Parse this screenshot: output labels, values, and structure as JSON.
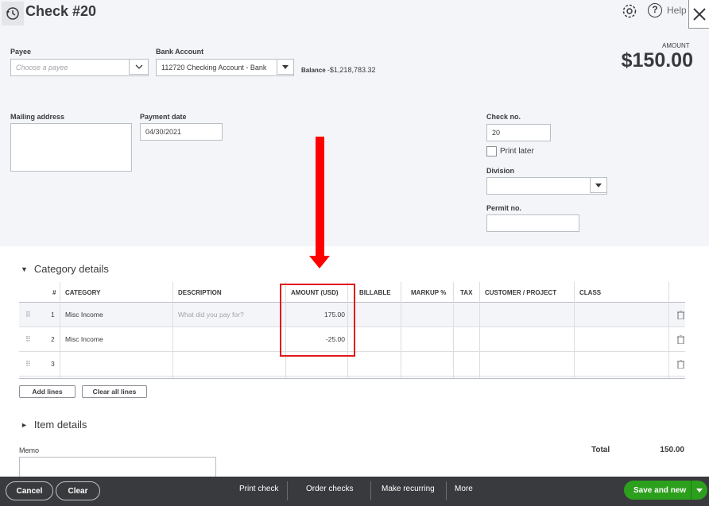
{
  "header": {
    "title": "Check #20",
    "help_label": "Help"
  },
  "form": {
    "payee_label": "Payee",
    "payee_placeholder": "Choose a payee",
    "bank_account_label": "Bank Account",
    "bank_account_value": "112720 Checking Account - Bank",
    "balance_label": "Balance",
    "balance_value": "-$1,218,783.32",
    "amount_label": "AMOUNT",
    "amount_value": "$150.00",
    "mailing_address_label": "Mailing address",
    "payment_date_label": "Payment date",
    "payment_date_value": "04/30/2021",
    "check_no_label": "Check no.",
    "check_no_value": "20",
    "print_later_label": "Print later",
    "division_label": "Division",
    "permit_no_label": "Permit no."
  },
  "category_details": {
    "title": "Category details",
    "columns": {
      "num": "#",
      "category": "CATEGORY",
      "description": "DESCRIPTION",
      "amount": "AMOUNT (USD)",
      "billable": "BILLABLE",
      "markup": "MARKUP %",
      "tax": "TAX",
      "customer": "CUSTOMER / PROJECT",
      "class": "CLASS"
    },
    "rows": [
      {
        "num": "1",
        "category": "Misc Income",
        "description_placeholder": "What did you pay for?",
        "amount": "175.00"
      },
      {
        "num": "2",
        "category": "Misc Income",
        "amount": "-25.00"
      },
      {
        "num": "3",
        "category": "",
        "amount": ""
      }
    ],
    "add_lines_label": "Add lines",
    "clear_lines_label": "Clear all lines"
  },
  "item_details": {
    "title": "Item details"
  },
  "memo_label": "Memo",
  "total_label": "Total",
  "total_value": "150.00",
  "footer": {
    "cancel": "Cancel",
    "clear": "Clear",
    "print_check": "Print check",
    "order_checks": "Order checks",
    "make_recurring": "Make recurring",
    "more": "More",
    "save_and_new": "Save and new"
  },
  "colors": {
    "annotation": "#e01a1a",
    "save_green": "#2ca01c",
    "footer_bg": "#393a3d"
  }
}
